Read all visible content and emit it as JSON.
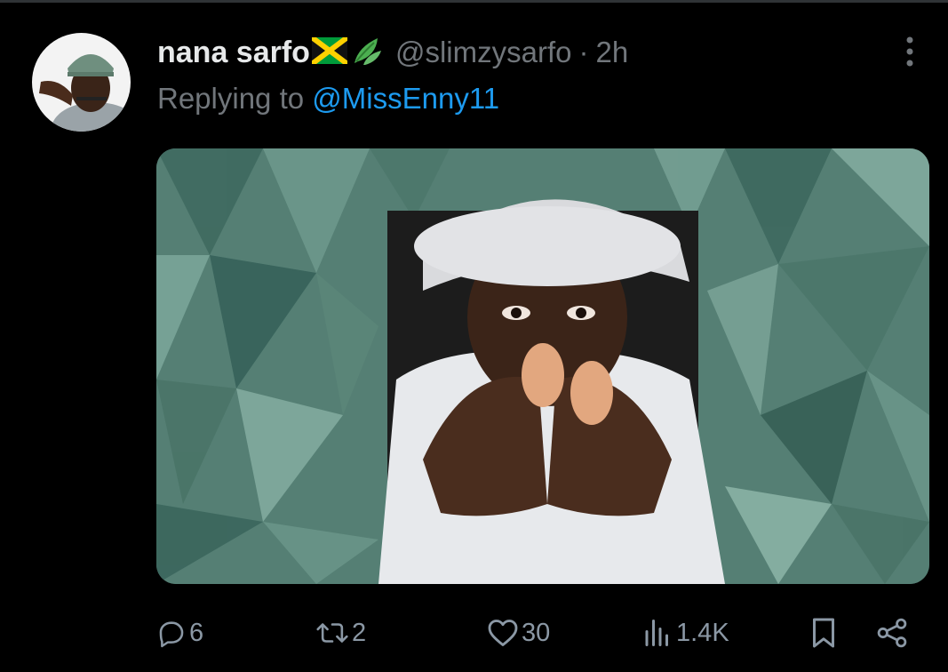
{
  "tweet": {
    "display_name": "nana sarfo",
    "handle": "@slimzysarfo",
    "separator": "·",
    "time": "2h",
    "replying_prefix": "Replying to",
    "replying_to": "@MissEnny11"
  },
  "actions": {
    "replies": "6",
    "reposts": "2",
    "likes": "30",
    "views": "1.4K"
  },
  "icons": {
    "avatar": "profile-photo",
    "name_emoji_1": "jamaica-flag-icon",
    "name_emoji_2": "herb-leaf-icon",
    "more": "more-vertical-icon",
    "reply": "reply-icon",
    "repost": "repost-icon",
    "like": "heart-icon",
    "views": "views-bar-chart-icon",
    "bookmark": "bookmark-icon",
    "share": "share-icon"
  },
  "colors": {
    "background": "#000000",
    "primary_text": "#e7e9ea",
    "secondary_text": "#71767b",
    "link": "#1d9bf0",
    "action_icons": "#8b98a5"
  }
}
